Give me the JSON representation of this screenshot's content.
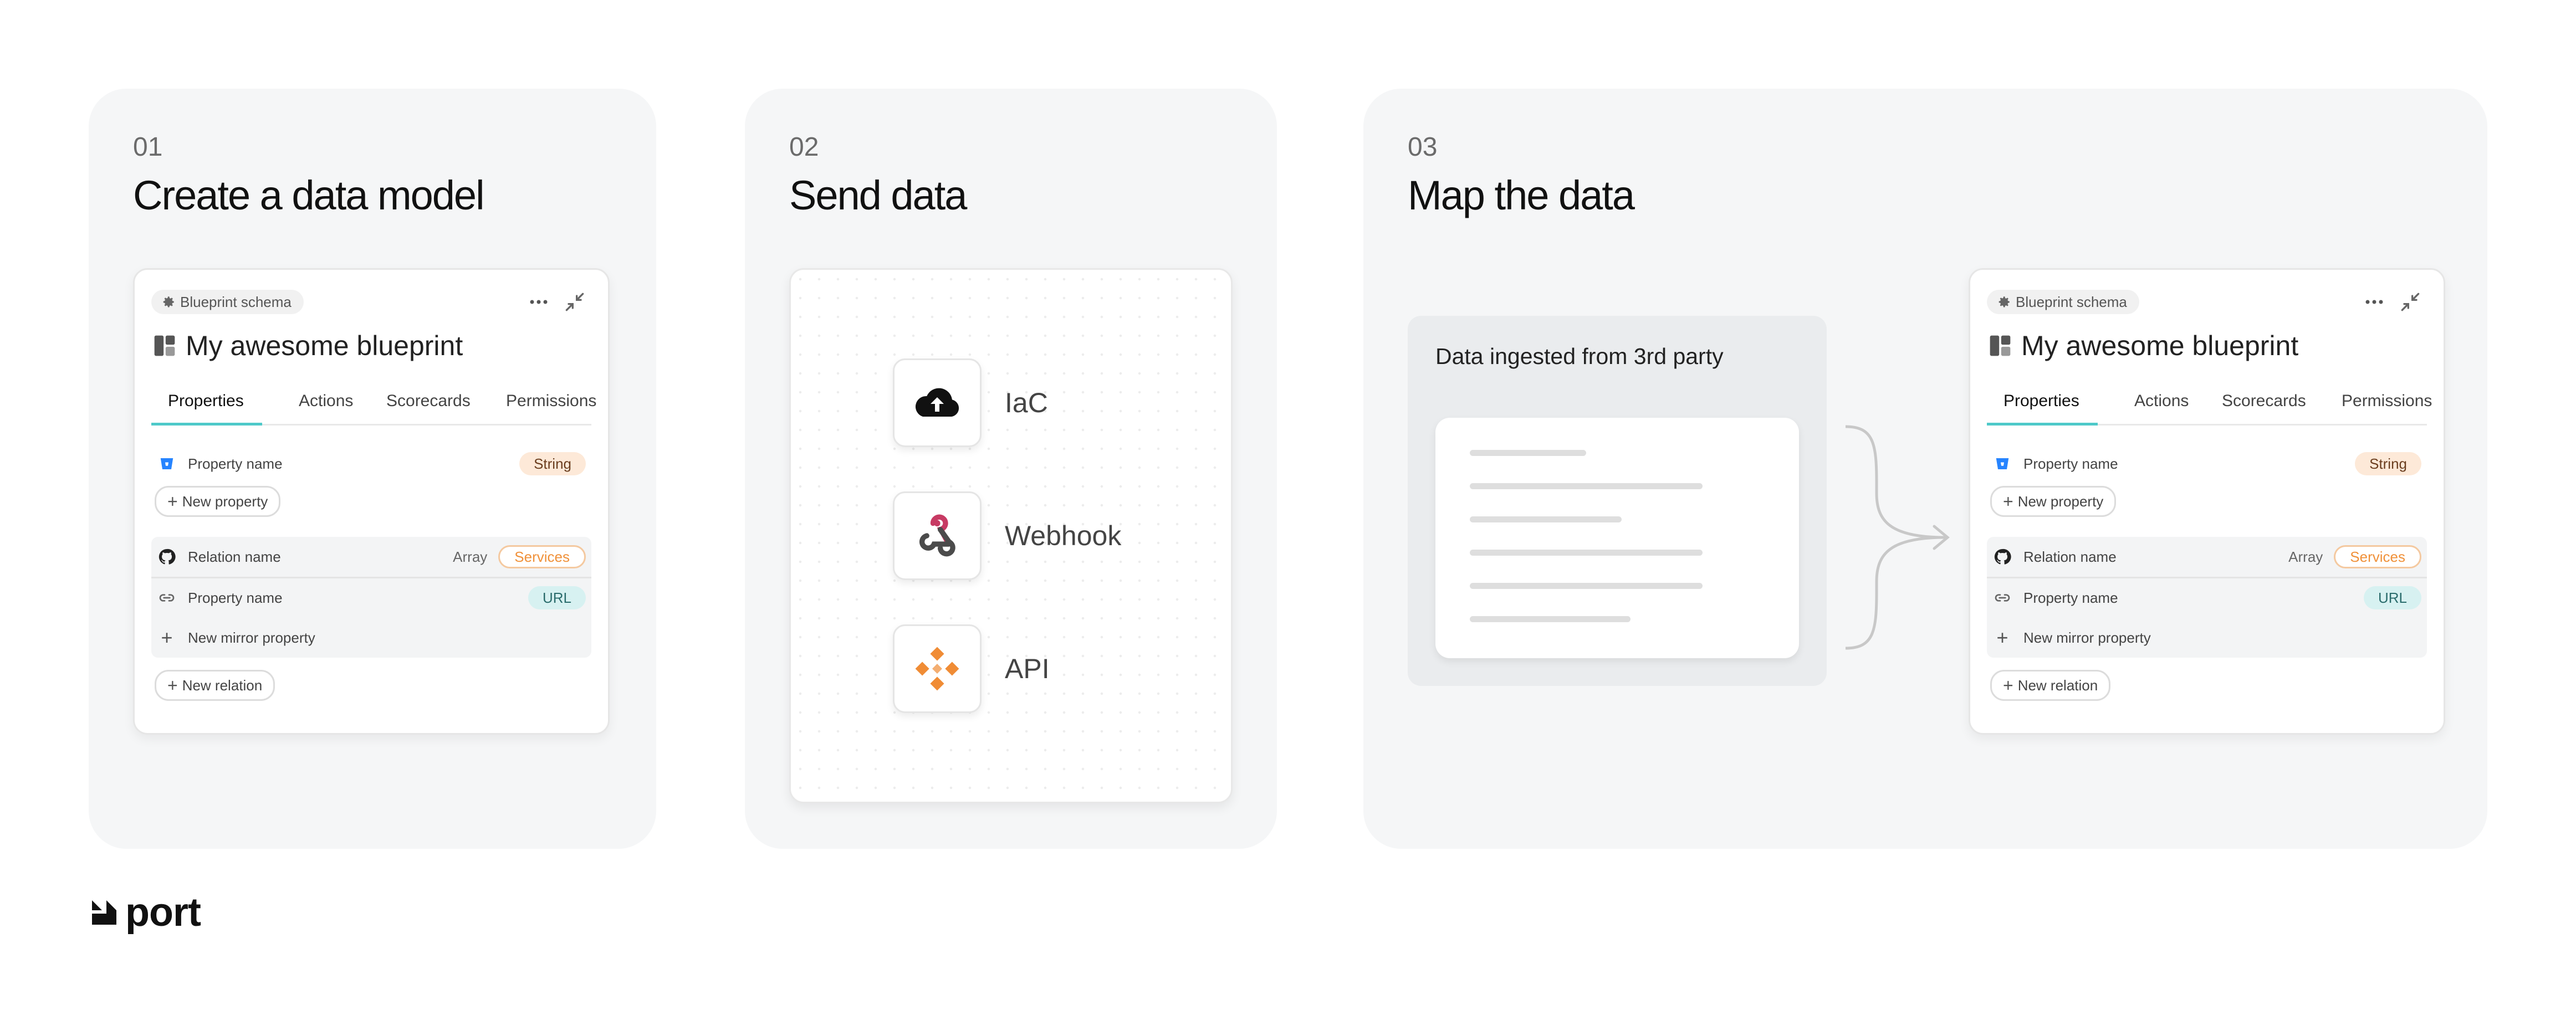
{
  "sections": [
    {
      "number": "01",
      "heading": "Create a data model"
    },
    {
      "number": "02",
      "heading": "Send data"
    },
    {
      "number": "03",
      "heading": "Map the data"
    }
  ],
  "blueprint": {
    "chip_label": "Blueprint schema",
    "title": "My awesome blueprint",
    "tabs": [
      "Properties",
      "Actions",
      "Scorecards",
      "Permissions"
    ],
    "active_tab": "Properties",
    "property_row": {
      "label": "Property name",
      "type": "String"
    },
    "new_property_label": "New property",
    "relation_row": {
      "label": "Relation name",
      "array_label": "Array",
      "target": "Services"
    },
    "mirror_row": {
      "label": "Property name",
      "type": "URL"
    },
    "new_mirror_label": "New mirror property",
    "new_relation_label": "New relation"
  },
  "sources": [
    {
      "label": "IaC",
      "icon": "cloud-upload-icon"
    },
    {
      "label": "Webhook",
      "icon": "webhook-icon"
    },
    {
      "label": "API",
      "icon": "api-icon"
    }
  ],
  "ingest": {
    "label": "Data ingested from 3rd party"
  },
  "colors": {
    "accent": "#4ec9c9",
    "string_pill": "#fde9d8",
    "url_pill": "#d7f1f1",
    "services": "#f0913a",
    "section_bg": "#f5f6f7"
  },
  "logo": {
    "text": "port"
  }
}
